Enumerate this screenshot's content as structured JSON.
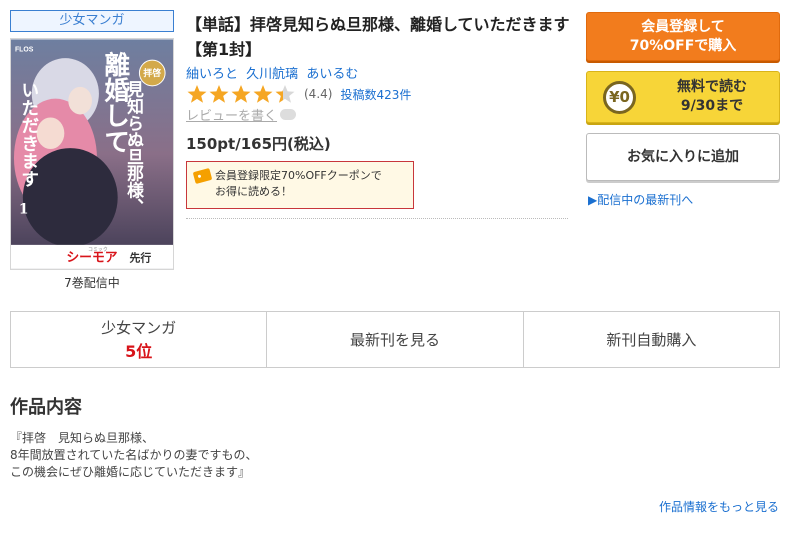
{
  "genre_badge": "少女マンガ",
  "cover": {
    "label_publisher": "FLOS",
    "label_title_small": "拝啓",
    "label_title_main": "見知らぬ旦那様、",
    "label_title_line2": "離婚して",
    "label_title_line3": "いただきます",
    "label_volume": "1",
    "label_cmoa": "シーモア",
    "label_advance": "先行",
    "label_comic": "コミック"
  },
  "dist_count": "7巻配信中",
  "title": "【単話】拝啓見知らぬ旦那様、離婚していただきます【第1封】",
  "authors": [
    "紬いろと",
    "久川航璃",
    "あいるむ"
  ],
  "rating": {
    "value_text": "(4.4)",
    "value": 4.4,
    "max": 5,
    "reviews": "投稿数423件",
    "write_review": "レビューを書く"
  },
  "price": "150pt/165円(税込)",
  "coupon": {
    "line1": "会員登録限定70%OFFクーポンで",
    "line2": "お得に読める！"
  },
  "buttons": {
    "register_line1": "会員登録して",
    "register_line2": "70%OFFで購入",
    "free_coin": "¥0",
    "free_line1": "無料で読む",
    "free_line2": "9/30まで",
    "favorite": "お気に入りに追加"
  },
  "latest_link": "▶配信中の最新刊へ",
  "tabs": {
    "genre": "少女マンガ",
    "rank": "5位",
    "latest": "最新刊を見る",
    "auto_buy": "新刊自動購入"
  },
  "section_title": "作品内容",
  "synopsis": [
    "『拝啓　見知らぬ旦那様、",
    "8年間放置されていた名ばかりの妻ですもの、",
    "この機会にぜひ離婚に応じていただきます』"
  ],
  "more_link": "作品情報をもっと見る",
  "colors": {
    "link": "#1a6fd0",
    "register_bg": "#f27c1d",
    "free_bg": "#f7d538",
    "star": "#f5a623",
    "rank": "#d8141a"
  }
}
